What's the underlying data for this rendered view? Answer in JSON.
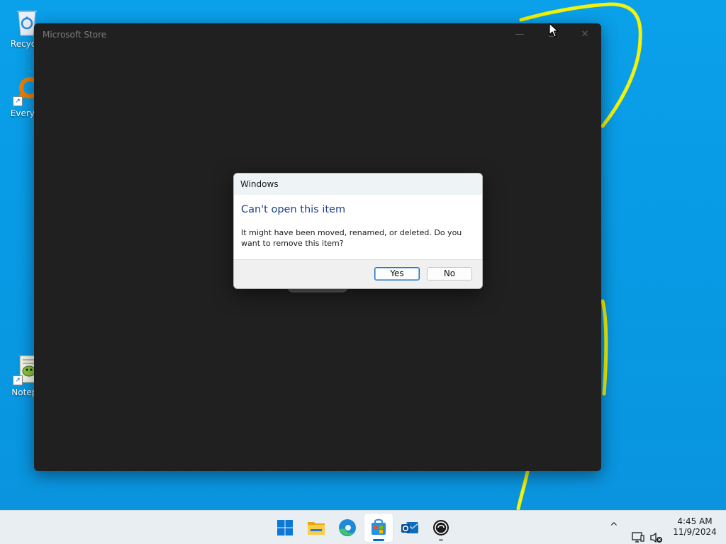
{
  "desktop": {
    "icons": [
      {
        "label": "Recycle",
        "name": "recycle-bin"
      },
      {
        "label": "Everyth",
        "name": "everything"
      },
      {
        "label": "Notepa",
        "name": "notepad"
      }
    ]
  },
  "window": {
    "title": "Microsoft Store",
    "minimize_label": "—",
    "maximize_label": "☐",
    "close_label": "✕"
  },
  "dialog": {
    "title": "Windows",
    "heading": "Can't open this item",
    "message": "It might have been moved, renamed, or deleted. Do you want to remove this item?",
    "yes_label": "Yes",
    "no_label": "No"
  },
  "taskbar": {
    "items": [
      "start",
      "file-explorer",
      "edge",
      "microsoft-store",
      "outlook",
      "app"
    ],
    "active": "microsoft-store",
    "tray": {
      "chevron_label": "^",
      "time": "4:45 AM",
      "date": "11/9/2024"
    }
  },
  "colors": {
    "desktop": "#0a9ae6",
    "window": "#202020",
    "dialog_heading": "#1f3f8a",
    "scribble": "#f2f20a",
    "taskbar": "#e9eef3"
  }
}
